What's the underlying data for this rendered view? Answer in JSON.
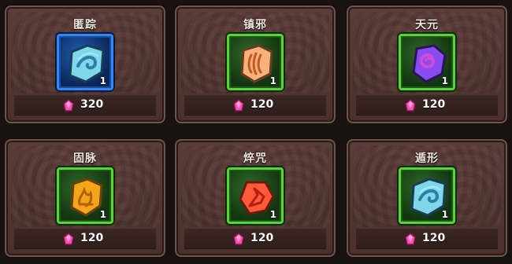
{
  "items": [
    {
      "name": "匿踪",
      "count": "1",
      "price": "320",
      "frame": "blue",
      "icon": "blue-wave-rune-icon"
    },
    {
      "name": "镇邪",
      "count": "1",
      "price": "120",
      "frame": "green",
      "icon": "orange-claw-rune-icon"
    },
    {
      "name": "天元",
      "count": "1",
      "price": "120",
      "frame": "green",
      "icon": "purple-swirl-rune-icon"
    },
    {
      "name": "固脉",
      "count": "1",
      "price": "120",
      "frame": "green",
      "icon": "amber-flame-rune-icon"
    },
    {
      "name": "焠咒",
      "count": "1",
      "price": "120",
      "frame": "green",
      "icon": "red-leaf-rune-icon"
    },
    {
      "name": "遁形",
      "count": "1",
      "price": "120",
      "frame": "green",
      "icon": "cyan-wave-rune-icon"
    }
  ],
  "currency_icon": "pink-gem-icon",
  "colors": {
    "card_bg": "#5b3d38",
    "green_frame": "#58d33a",
    "blue_frame": "#2f86ff",
    "gem": "#ff4fb0"
  }
}
